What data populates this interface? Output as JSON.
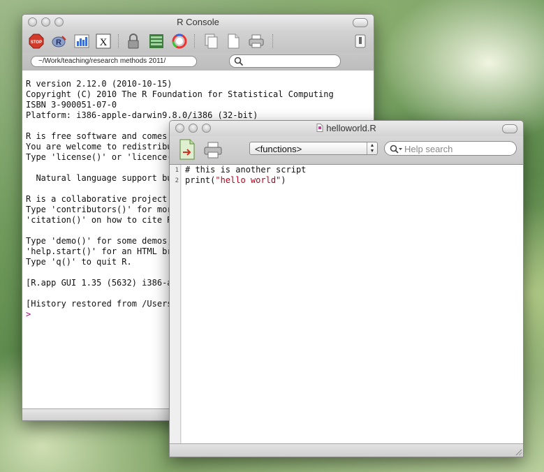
{
  "console": {
    "title": "R Console",
    "path": "~/Work/teaching/research methods 2011/",
    "search_placeholder": "",
    "toolbar_icons": [
      "stop-icon",
      "source-script-icon",
      "quartz-icon",
      "x11-icon",
      "lock-icon",
      "workspace-icon",
      "color-picker-icon",
      "copy-icon",
      "new-document-icon",
      "print-icon",
      "toggle-sidebar-icon"
    ],
    "output_lines": [
      "R version 2.12.0 (2010-10-15)",
      "Copyright (C) 2010 The R Foundation for Statistical Computing",
      "ISBN 3-900051-07-0",
      "Platform: i386-apple-darwin9.8.0/i386 (32-bit)",
      "",
      "R is free software and comes w",
      "You are welcome to redistribu",
      "Type 'license()' or 'licence()",
      "",
      "  Natural language support bu",
      "",
      "R is a collaborative project w",
      "Type 'contributors()' for more",
      "'citation()' on how to cite R",
      "",
      "Type 'demo()' for some demos,",
      "'help.start()' for an HTML bro",
      "Type 'q()' to quit R.",
      "",
      "[R.app GUI 1.35 (5632) i386-ap",
      "",
      "[History restored from /Users/"
    ],
    "prompt": ">"
  },
  "editor": {
    "title": "helloworld.R",
    "functions_select": "<functions>",
    "help_search_placeholder": "Help search",
    "line_numbers": [
      "1",
      "2"
    ],
    "code": {
      "line1": "# this is another script",
      "line2_prefix": "print(",
      "line2_string": "\"hello world\"",
      "line2_suffix": ")"
    }
  },
  "colors": {
    "prompt": "#b5007a",
    "string": "#b8001c"
  }
}
